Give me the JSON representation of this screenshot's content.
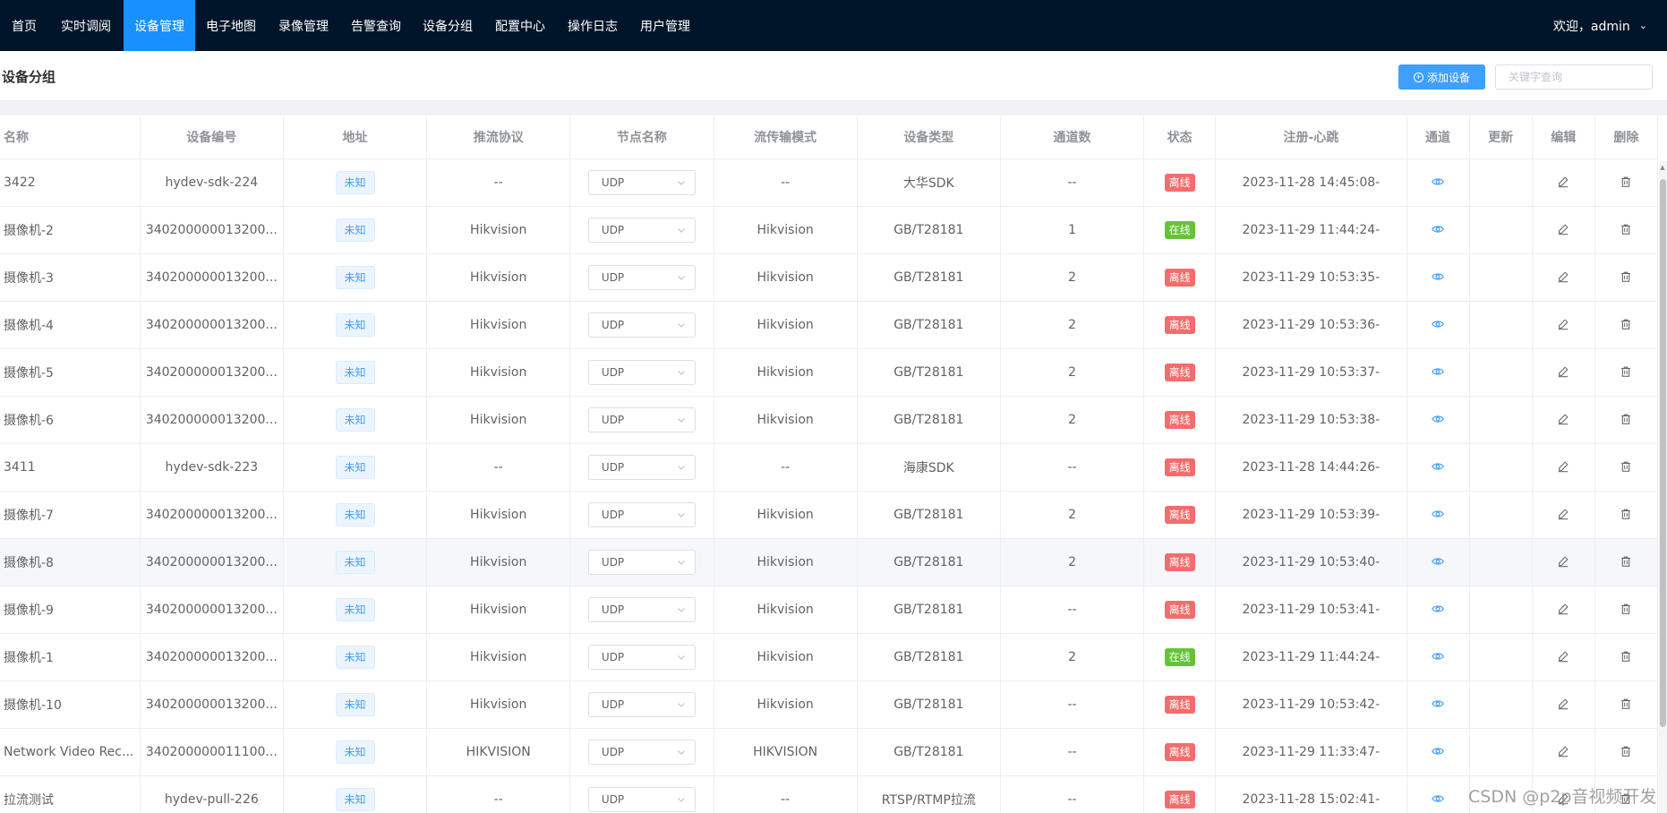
{
  "nav": {
    "items": [
      "首页",
      "实时调阅",
      "设备管理",
      "电子地图",
      "录像管理",
      "告警查询",
      "设备分组",
      "配置中心",
      "操作日志",
      "用户管理"
    ],
    "active_index": 2,
    "user": "欢迎，admin",
    "colors": {
      "bar": "#001529",
      "active": "#1890ff"
    }
  },
  "header": {
    "title": "设备分组",
    "add_button": "添加设备",
    "search_placeholder": "关键字查询"
  },
  "table": {
    "columns": [
      "名称",
      "设备编号",
      "地址",
      "推流协议",
      "节点名称",
      "流传输模式",
      "设备类型",
      "通道数",
      "状态",
      "注册-心跳",
      "通道",
      "更新",
      "编辑",
      "删除"
    ],
    "rows": [
      {
        "name": "3422",
        "id": "hydev-sdk-224",
        "addr": "未知",
        "proto": "--",
        "node": "UDP",
        "mode": "--",
        "type": "大华SDK",
        "channels": "--",
        "status": "离线",
        "online": false,
        "time": "2023-11-28 14:45:08-"
      },
      {
        "name": "摄像机-2",
        "id": "340200000013200...",
        "addr": "未知",
        "proto": "Hikvision",
        "node": "UDP",
        "mode": "Hikvision",
        "type": "GB/T28181",
        "channels": "1",
        "status": "在线",
        "online": true,
        "time": "2023-11-29 11:44:24-"
      },
      {
        "name": "摄像机-3",
        "id": "340200000013200...",
        "addr": "未知",
        "proto": "Hikvision",
        "node": "UDP",
        "mode": "Hikvision",
        "type": "GB/T28181",
        "channels": "2",
        "status": "离线",
        "online": false,
        "time": "2023-11-29 10:53:35-"
      },
      {
        "name": "摄像机-4",
        "id": "340200000013200...",
        "addr": "未知",
        "proto": "Hikvision",
        "node": "UDP",
        "mode": "Hikvision",
        "type": "GB/T28181",
        "channels": "2",
        "status": "离线",
        "online": false,
        "time": "2023-11-29 10:53:36-"
      },
      {
        "name": "摄像机-5",
        "id": "340200000013200...",
        "addr": "未知",
        "proto": "Hikvision",
        "node": "UDP",
        "mode": "Hikvision",
        "type": "GB/T28181",
        "channels": "2",
        "status": "离线",
        "online": false,
        "time": "2023-11-29 10:53:37-"
      },
      {
        "name": "摄像机-6",
        "id": "340200000013200...",
        "addr": "未知",
        "proto": "Hikvision",
        "node": "UDP",
        "mode": "Hikvision",
        "type": "GB/T28181",
        "channels": "2",
        "status": "离线",
        "online": false,
        "time": "2023-11-29 10:53:38-"
      },
      {
        "name": "3411",
        "id": "hydev-sdk-223",
        "addr": "未知",
        "proto": "--",
        "node": "UDP",
        "mode": "--",
        "type": "海康SDK",
        "channels": "--",
        "status": "离线",
        "online": false,
        "time": "2023-11-28 14:44:26-"
      },
      {
        "name": "摄像机-7",
        "id": "340200000013200...",
        "addr": "未知",
        "proto": "Hikvision",
        "node": "UDP",
        "mode": "Hikvision",
        "type": "GB/T28181",
        "channels": "2",
        "status": "离线",
        "online": false,
        "time": "2023-11-29 10:53:39-"
      },
      {
        "name": "摄像机-8",
        "id": "340200000013200...",
        "addr": "未知",
        "proto": "Hikvision",
        "node": "UDP",
        "mode": "Hikvision",
        "type": "GB/T28181",
        "channels": "2",
        "status": "离线",
        "online": false,
        "time": "2023-11-29 10:53:40-"
      },
      {
        "name": "摄像机-9",
        "id": "340200000013200...",
        "addr": "未知",
        "proto": "Hikvision",
        "node": "UDP",
        "mode": "Hikvision",
        "type": "GB/T28181",
        "channels": "--",
        "status": "离线",
        "online": false,
        "time": "2023-11-29 10:53:41-"
      },
      {
        "name": "摄像机-1",
        "id": "340200000013200...",
        "addr": "未知",
        "proto": "Hikvision",
        "node": "UDP",
        "mode": "Hikvision",
        "type": "GB/T28181",
        "channels": "2",
        "status": "在线",
        "online": true,
        "time": "2023-11-29 11:44:24-"
      },
      {
        "name": "摄像机-10",
        "id": "340200000013200...",
        "addr": "未知",
        "proto": "Hikvision",
        "node": "UDP",
        "mode": "Hikvision",
        "type": "GB/T28181",
        "channels": "--",
        "status": "离线",
        "online": false,
        "time": "2023-11-29 10:53:42-"
      },
      {
        "name": "Network Video Rec...",
        "id": "340200000011100...",
        "addr": "未知",
        "proto": "HIKVISION",
        "node": "UDP",
        "mode": "HIKVISION",
        "type": "GB/T28181",
        "channels": "--",
        "status": "离线",
        "online": false,
        "time": "2023-11-29 11:33:47-"
      },
      {
        "name": "拉流测试",
        "id": "hydev-pull-226",
        "addr": "未知",
        "proto": "--",
        "node": "UDP",
        "mode": "--",
        "type": "RTSP/RTMP拉流",
        "channels": "--",
        "status": "离线",
        "online": false,
        "time": "2023-11-28 15:02:41-"
      }
    ],
    "hover_row_index": 8,
    "icons": {
      "channel": "eye-icon",
      "edit": "edit-pen-icon",
      "delete": "trash-icon"
    }
  },
  "watermark": "CSDN @p2p音视频开发"
}
